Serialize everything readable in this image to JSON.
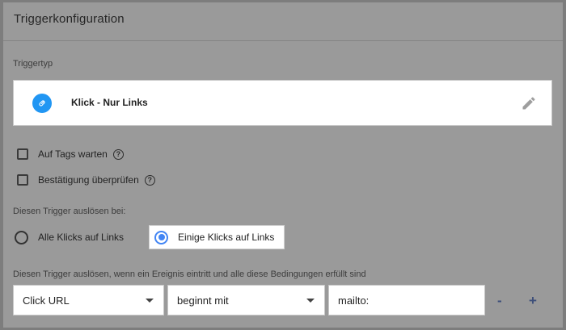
{
  "panel": {
    "title": "Triggerkonfiguration"
  },
  "trigger_type": {
    "section_label": "Triggertyp",
    "name": "Klick - Nur Links",
    "icon": "link-icon",
    "edit_icon": "pencil-icon",
    "accent_color": "#2196f3"
  },
  "options": {
    "wait_for_tags": {
      "label": "Auf Tags warten",
      "checked": false
    },
    "check_validation": {
      "label": "Bestätigung überprüfen",
      "checked": false
    },
    "help_glyph": "?"
  },
  "fire_on": {
    "section_label": "Diesen Trigger auslösen bei:",
    "all_links_label": "Alle Klicks auf Links",
    "some_links_label": "Einige Klicks auf Links",
    "selected": "some_links",
    "selected_color": "#4285f4"
  },
  "conditions": {
    "section_label": "Diesen Trigger auslösen, wenn ein Ereignis eintritt und alle diese Bedingungen erfüllt sind",
    "variable": "Click URL",
    "operator": "beginnt mit",
    "value": "mailto:",
    "remove_label": "-",
    "add_label": "+"
  }
}
